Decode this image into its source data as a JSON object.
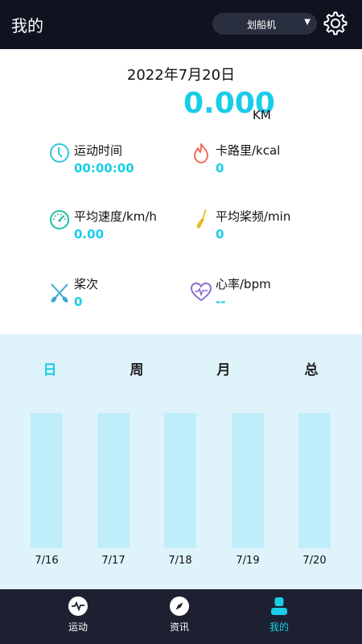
{
  "header": {
    "title": "我的",
    "device": "划船机",
    "settings_icon": "gear-icon"
  },
  "summary": {
    "date": "2022年7月20日",
    "distance": "0.000",
    "unit": "KM"
  },
  "stats": {
    "duration": {
      "label": "运动时间",
      "value": "00:00:00",
      "icon": "clock-icon",
      "color": "#19cde8"
    },
    "calories": {
      "label": "卡路里/kcal",
      "value": "0",
      "icon": "flame-icon",
      "color": "#19cde8"
    },
    "avg_speed": {
      "label": "平均速度/km/h",
      "value": "0.00",
      "icon": "speedometer-icon",
      "color": "#19cde8"
    },
    "stroke_rate": {
      "label": "平均桨频/min",
      "value": "0",
      "icon": "paddle-icon",
      "color": "#19cde8"
    },
    "strokes": {
      "label": "桨次",
      "value": "0",
      "icon": "crossed-oars-icon",
      "color": "#19cde8"
    },
    "heart_rate": {
      "label": "心率/bpm",
      "value": "--",
      "icon": "heart-pulse-icon",
      "color": "#19cde8"
    }
  },
  "history": {
    "tabs": [
      {
        "label": "日",
        "active": true
      },
      {
        "label": "周",
        "active": false
      },
      {
        "label": "月",
        "active": false
      },
      {
        "label": "总",
        "active": false
      }
    ],
    "chart_data": {
      "type": "bar",
      "categories": [
        "7/16",
        "7/17",
        "7/18",
        "7/19",
        "7/20"
      ],
      "values": [
        0,
        0,
        0,
        0,
        0
      ]
    }
  },
  "nav": {
    "items": [
      {
        "label": "运动",
        "icon": "activity-icon",
        "active": false
      },
      {
        "label": "资讯",
        "icon": "compass-icon",
        "active": false
      },
      {
        "label": "我的",
        "icon": "user-icon",
        "active": true
      }
    ]
  },
  "colors": {
    "accent": "#19cde8",
    "header_bg": "#0f1320",
    "nav_bg": "#1c2030",
    "history_bg": "#dff3fb",
    "bar": "#bfeefa"
  }
}
